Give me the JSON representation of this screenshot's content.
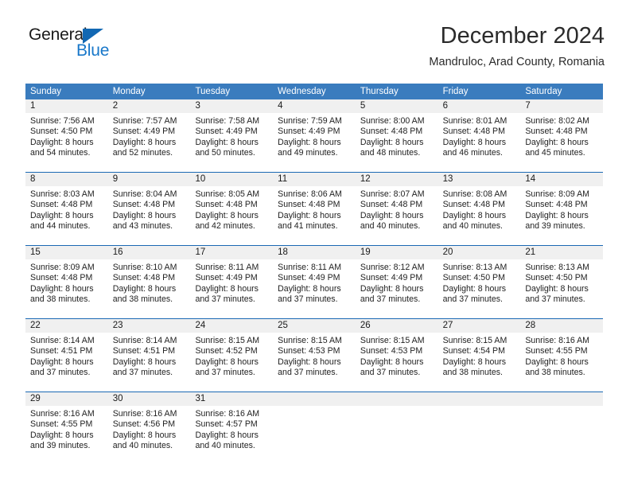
{
  "brand": {
    "name_part1": "General",
    "name_part2": "Blue",
    "triangle_color": "#1268b3",
    "blue_color": "#1877c9"
  },
  "header": {
    "title": "December 2024",
    "subtitle": "Mandruloc, Arad County, Romania"
  },
  "colors": {
    "header_blue": "#3a7cbe",
    "separator_blue": "#1b69b4",
    "daynum_band": "#f0f0f0"
  },
  "weekdays": [
    "Sunday",
    "Monday",
    "Tuesday",
    "Wednesday",
    "Thursday",
    "Friday",
    "Saturday"
  ],
  "weeks": [
    {
      "days": [
        {
          "num": "1",
          "sunrise": "Sunrise: 7:56 AM",
          "sunset": "Sunset: 4:50 PM",
          "daylight1": "Daylight: 8 hours",
          "daylight2": "and 54 minutes."
        },
        {
          "num": "2",
          "sunrise": "Sunrise: 7:57 AM",
          "sunset": "Sunset: 4:49 PM",
          "daylight1": "Daylight: 8 hours",
          "daylight2": "and 52 minutes."
        },
        {
          "num": "3",
          "sunrise": "Sunrise: 7:58 AM",
          "sunset": "Sunset: 4:49 PM",
          "daylight1": "Daylight: 8 hours",
          "daylight2": "and 50 minutes."
        },
        {
          "num": "4",
          "sunrise": "Sunrise: 7:59 AM",
          "sunset": "Sunset: 4:49 PM",
          "daylight1": "Daylight: 8 hours",
          "daylight2": "and 49 minutes."
        },
        {
          "num": "5",
          "sunrise": "Sunrise: 8:00 AM",
          "sunset": "Sunset: 4:48 PM",
          "daylight1": "Daylight: 8 hours",
          "daylight2": "and 48 minutes."
        },
        {
          "num": "6",
          "sunrise": "Sunrise: 8:01 AM",
          "sunset": "Sunset: 4:48 PM",
          "daylight1": "Daylight: 8 hours",
          "daylight2": "and 46 minutes."
        },
        {
          "num": "7",
          "sunrise": "Sunrise: 8:02 AM",
          "sunset": "Sunset: 4:48 PM",
          "daylight1": "Daylight: 8 hours",
          "daylight2": "and 45 minutes."
        }
      ]
    },
    {
      "days": [
        {
          "num": "8",
          "sunrise": "Sunrise: 8:03 AM",
          "sunset": "Sunset: 4:48 PM",
          "daylight1": "Daylight: 8 hours",
          "daylight2": "and 44 minutes."
        },
        {
          "num": "9",
          "sunrise": "Sunrise: 8:04 AM",
          "sunset": "Sunset: 4:48 PM",
          "daylight1": "Daylight: 8 hours",
          "daylight2": "and 43 minutes."
        },
        {
          "num": "10",
          "sunrise": "Sunrise: 8:05 AM",
          "sunset": "Sunset: 4:48 PM",
          "daylight1": "Daylight: 8 hours",
          "daylight2": "and 42 minutes."
        },
        {
          "num": "11",
          "sunrise": "Sunrise: 8:06 AM",
          "sunset": "Sunset: 4:48 PM",
          "daylight1": "Daylight: 8 hours",
          "daylight2": "and 41 minutes."
        },
        {
          "num": "12",
          "sunrise": "Sunrise: 8:07 AM",
          "sunset": "Sunset: 4:48 PM",
          "daylight1": "Daylight: 8 hours",
          "daylight2": "and 40 minutes."
        },
        {
          "num": "13",
          "sunrise": "Sunrise: 8:08 AM",
          "sunset": "Sunset: 4:48 PM",
          "daylight1": "Daylight: 8 hours",
          "daylight2": "and 40 minutes."
        },
        {
          "num": "14",
          "sunrise": "Sunrise: 8:09 AM",
          "sunset": "Sunset: 4:48 PM",
          "daylight1": "Daylight: 8 hours",
          "daylight2": "and 39 minutes."
        }
      ]
    },
    {
      "days": [
        {
          "num": "15",
          "sunrise": "Sunrise: 8:09 AM",
          "sunset": "Sunset: 4:48 PM",
          "daylight1": "Daylight: 8 hours",
          "daylight2": "and 38 minutes."
        },
        {
          "num": "16",
          "sunrise": "Sunrise: 8:10 AM",
          "sunset": "Sunset: 4:48 PM",
          "daylight1": "Daylight: 8 hours",
          "daylight2": "and 38 minutes."
        },
        {
          "num": "17",
          "sunrise": "Sunrise: 8:11 AM",
          "sunset": "Sunset: 4:49 PM",
          "daylight1": "Daylight: 8 hours",
          "daylight2": "and 37 minutes."
        },
        {
          "num": "18",
          "sunrise": "Sunrise: 8:11 AM",
          "sunset": "Sunset: 4:49 PM",
          "daylight1": "Daylight: 8 hours",
          "daylight2": "and 37 minutes."
        },
        {
          "num": "19",
          "sunrise": "Sunrise: 8:12 AM",
          "sunset": "Sunset: 4:49 PM",
          "daylight1": "Daylight: 8 hours",
          "daylight2": "and 37 minutes."
        },
        {
          "num": "20",
          "sunrise": "Sunrise: 8:13 AM",
          "sunset": "Sunset: 4:50 PM",
          "daylight1": "Daylight: 8 hours",
          "daylight2": "and 37 minutes."
        },
        {
          "num": "21",
          "sunrise": "Sunrise: 8:13 AM",
          "sunset": "Sunset: 4:50 PM",
          "daylight1": "Daylight: 8 hours",
          "daylight2": "and 37 minutes."
        }
      ]
    },
    {
      "days": [
        {
          "num": "22",
          "sunrise": "Sunrise: 8:14 AM",
          "sunset": "Sunset: 4:51 PM",
          "daylight1": "Daylight: 8 hours",
          "daylight2": "and 37 minutes."
        },
        {
          "num": "23",
          "sunrise": "Sunrise: 8:14 AM",
          "sunset": "Sunset: 4:51 PM",
          "daylight1": "Daylight: 8 hours",
          "daylight2": "and 37 minutes."
        },
        {
          "num": "24",
          "sunrise": "Sunrise: 8:15 AM",
          "sunset": "Sunset: 4:52 PM",
          "daylight1": "Daylight: 8 hours",
          "daylight2": "and 37 minutes."
        },
        {
          "num": "25",
          "sunrise": "Sunrise: 8:15 AM",
          "sunset": "Sunset: 4:53 PM",
          "daylight1": "Daylight: 8 hours",
          "daylight2": "and 37 minutes."
        },
        {
          "num": "26",
          "sunrise": "Sunrise: 8:15 AM",
          "sunset": "Sunset: 4:53 PM",
          "daylight1": "Daylight: 8 hours",
          "daylight2": "and 37 minutes."
        },
        {
          "num": "27",
          "sunrise": "Sunrise: 8:15 AM",
          "sunset": "Sunset: 4:54 PM",
          "daylight1": "Daylight: 8 hours",
          "daylight2": "and 38 minutes."
        },
        {
          "num": "28",
          "sunrise": "Sunrise: 8:16 AM",
          "sunset": "Sunset: 4:55 PM",
          "daylight1": "Daylight: 8 hours",
          "daylight2": "and 38 minutes."
        }
      ]
    },
    {
      "days": [
        {
          "num": "29",
          "sunrise": "Sunrise: 8:16 AM",
          "sunset": "Sunset: 4:55 PM",
          "daylight1": "Daylight: 8 hours",
          "daylight2": "and 39 minutes."
        },
        {
          "num": "30",
          "sunrise": "Sunrise: 8:16 AM",
          "sunset": "Sunset: 4:56 PM",
          "daylight1": "Daylight: 8 hours",
          "daylight2": "and 40 minutes."
        },
        {
          "num": "31",
          "sunrise": "Sunrise: 8:16 AM",
          "sunset": "Sunset: 4:57 PM",
          "daylight1": "Daylight: 8 hours",
          "daylight2": "and 40 minutes."
        },
        {
          "num": "",
          "sunrise": "",
          "sunset": "",
          "daylight1": "",
          "daylight2": ""
        },
        {
          "num": "",
          "sunrise": "",
          "sunset": "",
          "daylight1": "",
          "daylight2": ""
        },
        {
          "num": "",
          "sunrise": "",
          "sunset": "",
          "daylight1": "",
          "daylight2": ""
        },
        {
          "num": "",
          "sunrise": "",
          "sunset": "",
          "daylight1": "",
          "daylight2": ""
        }
      ]
    }
  ]
}
